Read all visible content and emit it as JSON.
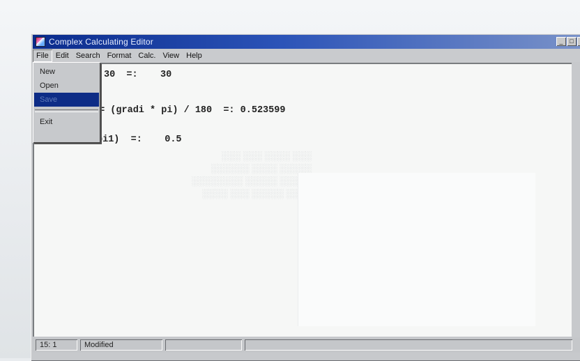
{
  "window": {
    "title": "Complex Calculating Editor",
    "controls": [
      "_",
      "□",
      "×"
    ]
  },
  "menubar": {
    "items": [
      "File",
      "Edit",
      "Search",
      "Format",
      "Calc.",
      "View",
      "Help"
    ]
  },
  "file_menu": {
    "items": [
      "New",
      "Open",
      "Save",
      "Exit"
    ],
    "selected": "Save"
  },
  "editor": {
    "lines": [
      "30  =:    30",
      ":= (gradi * pi) / 180  =: 0.523599",
      "pi1)  =:    0.5"
    ]
  },
  "statusbar": {
    "position": "15: 1",
    "state": "Modified"
  },
  "colors": {
    "titlebar_start": "#0a2b8c",
    "selection": "#0d2c86",
    "window_face": "#c7c9cc"
  }
}
